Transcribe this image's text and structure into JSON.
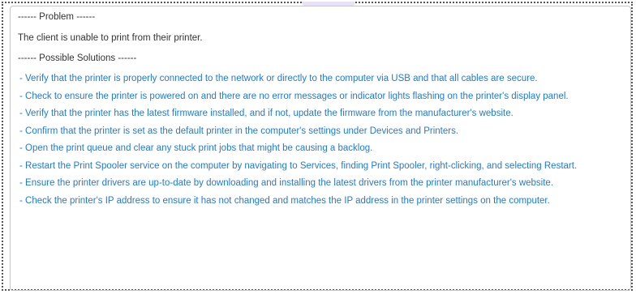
{
  "problem_heading": "------ Problem ------",
  "problem_text": "The client is unable to print from their printer.",
  "solutions_heading": "------ Possible Solutions ------",
  "solutions": [
    "- Verify that the printer is properly connected to the network or directly to the computer via USB and that all cables are secure.",
    "- Check to ensure the printer is powered on and there are no error messages or indicator lights flashing on the printer's display panel.",
    "- Verify that the printer has the latest firmware installed, and if not, update the firmware from the manufacturer's website.",
    "- Confirm that the printer is set as the default printer in the computer's settings under Devices and Printers.",
    "- Open the print queue and clear any stuck print jobs that might be causing a backlog.",
    "- Restart the Print Spooler service on the computer by navigating to Services, finding Print Spooler, right-clicking, and selecting Restart.",
    "- Ensure the printer drivers are up-to-date by downloading and installing the latest drivers from the printer manufacturer's website.",
    "- Check the printer's IP address to ensure it has not changed and matches the IP address in the printer settings on the computer."
  ],
  "colors": {
    "solution_text": "#1f7ad6",
    "body_text": "#333333",
    "panel_border": "#c7c7c7",
    "frame_border": "#555555"
  }
}
